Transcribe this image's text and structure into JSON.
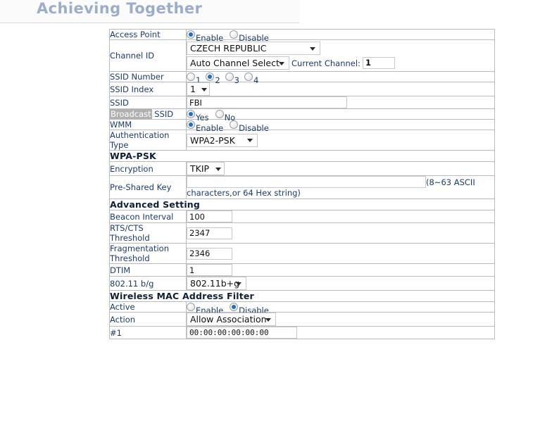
{
  "banner": {
    "title": "Achieving Together"
  },
  "labels": {
    "access_point": "Access Point",
    "channel_id": "Channel ID",
    "ssid_number": "SSID Number",
    "ssid_index": "SSID Index",
    "ssid": "SSID",
    "broadcast_hl": "Broadcast",
    "broadcast_rest": " SSID",
    "wmm": "WMM",
    "auth_type": "Authentication Type",
    "encryption": "Encryption",
    "psk": "Pre-Shared Key",
    "beacon_interval": "Beacon Interval",
    "rts_cts": "RTS/CTS Threshold",
    "fragmentation": "Fragmentation Threshold",
    "dtim": "DTIM",
    "mode_80211": "802.11 b/g",
    "active": "Active",
    "action": "Action",
    "mac_1": "#1",
    "current_channel": "Current Channel:"
  },
  "sections": {
    "wpa_psk": "WPA-PSK",
    "advanced": "Advanced Setting",
    "mac_filter": "Wireless MAC Address Filter"
  },
  "radios": {
    "enable": "Enable",
    "disable": "Disable",
    "yes": "Yes",
    "no": "No",
    "ssid_numbers": [
      "1",
      "2",
      "3",
      "4"
    ]
  },
  "state": {
    "access_point": "Enable",
    "ssid_number_selected": "2",
    "broadcast_ssid": "Yes",
    "wmm": "Enable",
    "mac_active": "Disable"
  },
  "values": {
    "country": "CZECH REPUBLIC",
    "channel_select": "Auto Channel Select",
    "current_channel": "1",
    "ssid_index": "1",
    "ssid": "FBI",
    "auth_type": "WPA2-PSK",
    "encryption": "TKIP",
    "psk": "",
    "beacon_interval": "100",
    "rts_cts": "2347",
    "fragmentation": "2346",
    "dtim": "1",
    "mode_80211": "802.11b+g",
    "action": "Allow Association",
    "mac_1": "00:00:00:00:00:00"
  },
  "hints": {
    "psk_hint": "(8~63 ASCII characters,or 64 Hex string)"
  },
  "colors": {
    "section_header_bg": "#a9c5e3",
    "label_text": "#1b3d6e",
    "banner_title": "#9aaecb",
    "radio_dot": "#1c6fc4",
    "selection_highlight": "#b0b0b0"
  }
}
